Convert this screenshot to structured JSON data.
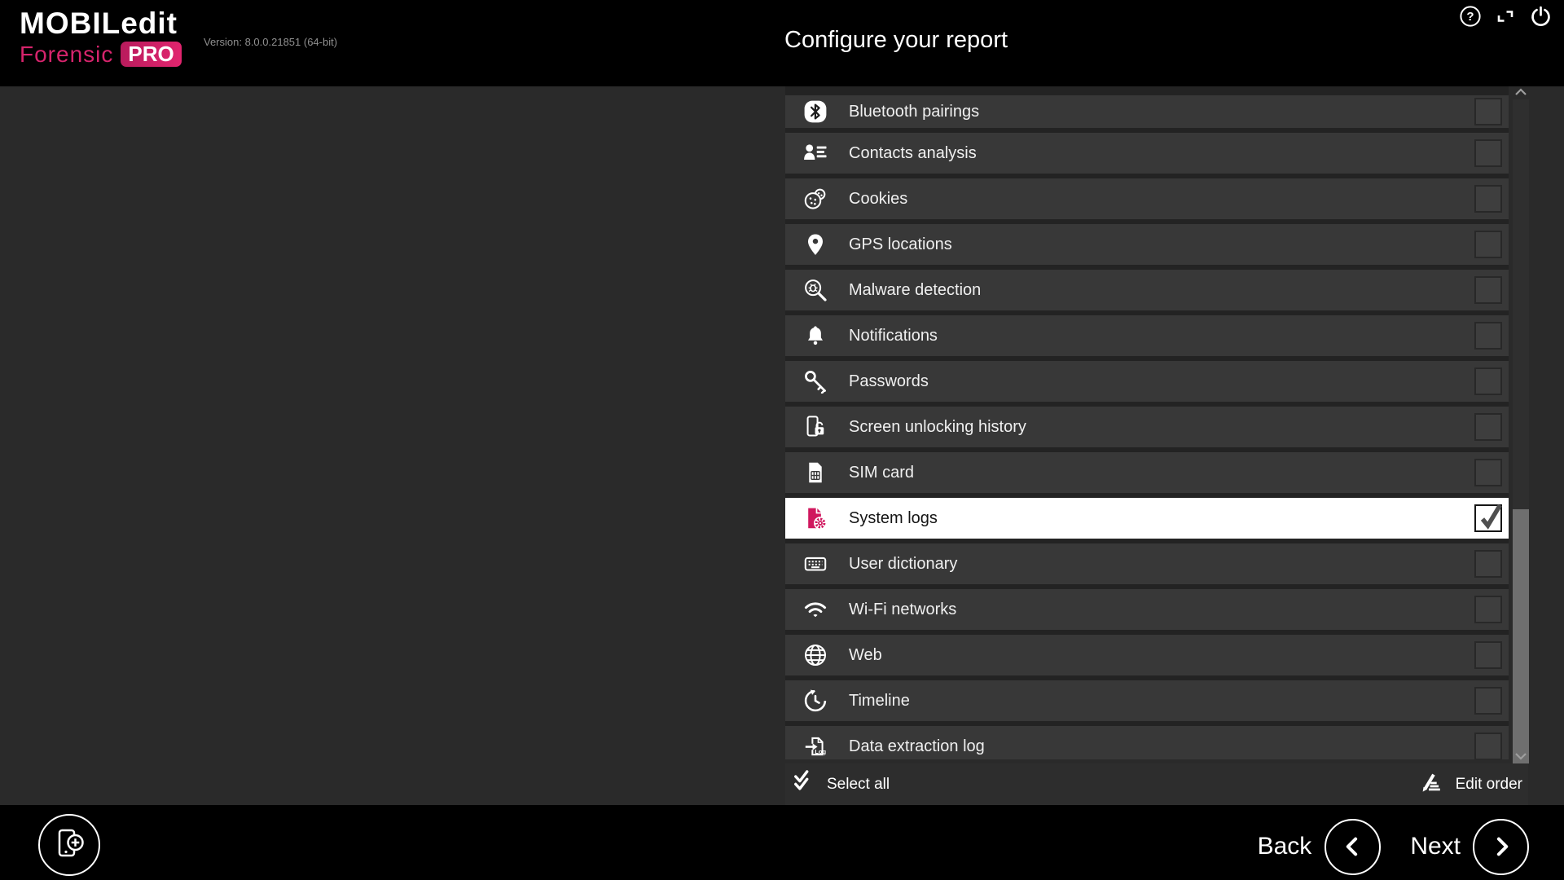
{
  "window": {
    "logo": {
      "line1": "MOBILedit",
      "line2": "Forensic",
      "badge": "PRO"
    },
    "version": "Version: 8.0.0.21851 (64-bit)",
    "title": "Configure your report",
    "controls": [
      "help-icon",
      "dock-window-icon",
      "power-icon"
    ]
  },
  "report_sections": {
    "items": [
      {
        "label": "Bluetooth pairings",
        "icon": "bluetooth-icon",
        "checked": false,
        "selected": false
      },
      {
        "label": "Contacts analysis",
        "icon": "contacts-analysis-icon",
        "checked": false,
        "selected": false
      },
      {
        "label": "Cookies",
        "icon": "cookies-icon",
        "checked": false,
        "selected": false
      },
      {
        "label": "GPS locations",
        "icon": "gps-locations-icon",
        "checked": false,
        "selected": false
      },
      {
        "label": "Malware detection",
        "icon": "malware-detection-icon",
        "checked": false,
        "selected": false
      },
      {
        "label": "Notifications",
        "icon": "notifications-icon",
        "checked": false,
        "selected": false
      },
      {
        "label": "Passwords",
        "icon": "passwords-icon",
        "checked": false,
        "selected": false
      },
      {
        "label": "Screen unlocking history",
        "icon": "screen-unlocking-icon",
        "checked": false,
        "selected": false
      },
      {
        "label": "SIM card",
        "icon": "sim-card-icon",
        "checked": false,
        "selected": false
      },
      {
        "label": "System logs",
        "icon": "system-logs-icon",
        "checked": true,
        "selected": true
      },
      {
        "label": "User dictionary",
        "icon": "user-dictionary-icon",
        "checked": false,
        "selected": false
      },
      {
        "label": "Wi-Fi networks",
        "icon": "wifi-networks-icon",
        "checked": false,
        "selected": false
      },
      {
        "label": "Web",
        "icon": "web-icon",
        "checked": false,
        "selected": false
      },
      {
        "label": "Timeline",
        "icon": "timeline-icon",
        "checked": false,
        "selected": false
      },
      {
        "label": "Data extraction log",
        "icon": "data-extraction-log-icon",
        "checked": false,
        "selected": false
      }
    ],
    "footer": {
      "select_all": "Select all",
      "edit_order": "Edit order"
    }
  },
  "navigation": {
    "back": "Back",
    "next": "Next"
  },
  "colors": {
    "accent_pink": "#d6246c",
    "header_bg": "#000000",
    "page_bg": "#2a2a2a",
    "row_bg": "#383838",
    "selected_row_bg": "#ffffff",
    "scroll_thumb": "#6f6f6f"
  }
}
